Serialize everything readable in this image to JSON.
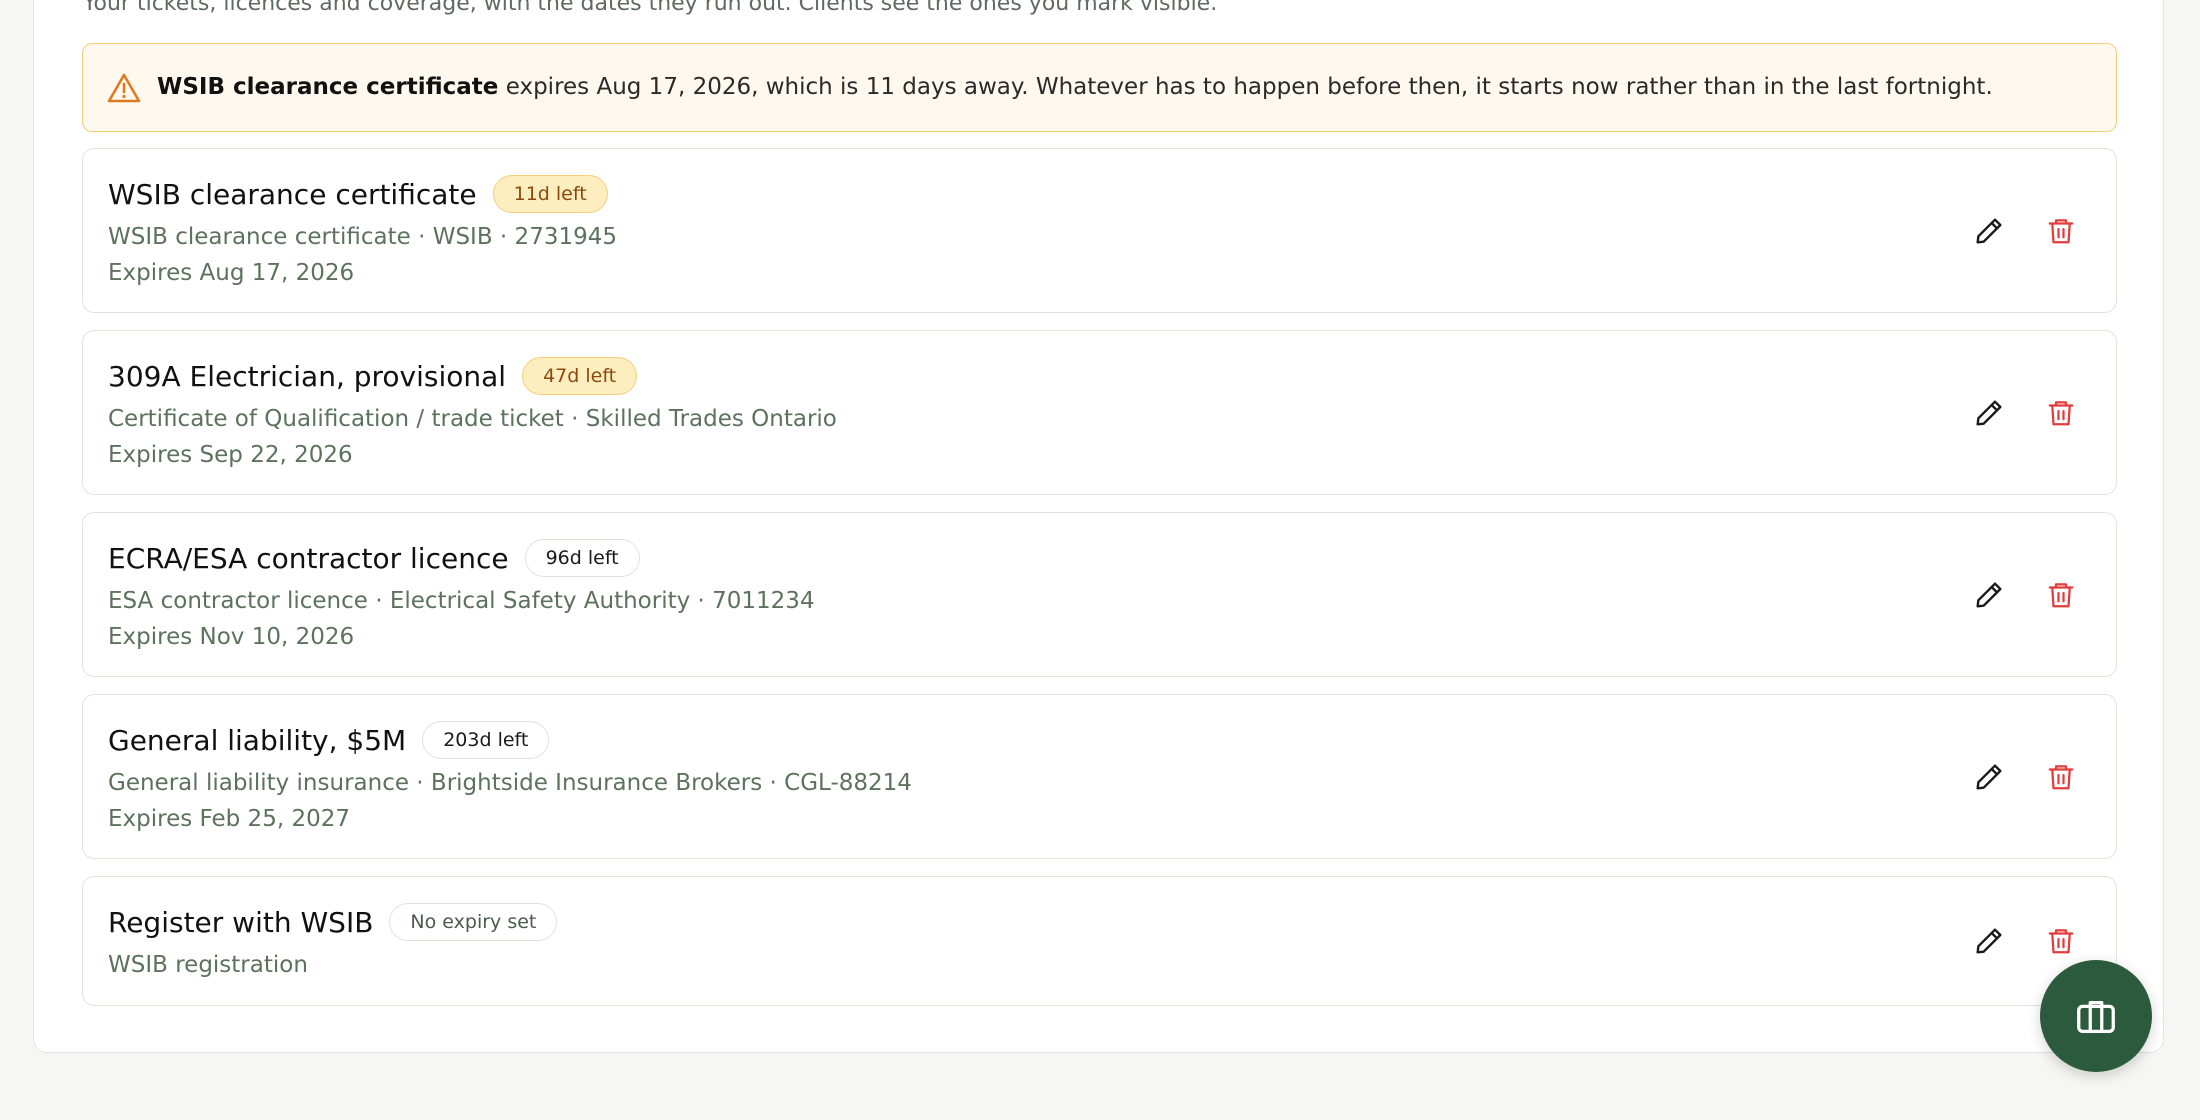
{
  "intro_text": "Your tickets, licences and coverage, with the dates they run out. Clients see the ones you mark visible.",
  "alert": {
    "icon": "warning-triangle-icon",
    "bold": "WSIB clearance certificate",
    "text": " expires Aug 17, 2026, which is 11 days away. Whatever has to happen before then, it starts now rather than in the last fortnight."
  },
  "credentials": [
    {
      "title": "WSIB clearance certificate",
      "badge": "11d left",
      "meta": "WSIB clearance certificate · WSIB · 2731945",
      "expires": "Expires Aug 17, 2026"
    },
    {
      "title": "309A Electrician, provisional",
      "badge": "47d left",
      "meta": "Certificate of Qualification / trade ticket · Skilled Trades Ontario",
      "expires": "Expires Sep 22, 2026"
    },
    {
      "title": "ECRA/ESA contractor licence",
      "badge": "96d left",
      "meta": "ESA contractor licence · Electrical Safety Authority · 7011234",
      "expires": "Expires Nov 10, 2026"
    },
    {
      "title": "General liability, $5M",
      "badge": "203d left",
      "meta": "General liability insurance · Brightside Insurance Brokers · CGL-88214",
      "expires": "Expires Feb 25, 2027"
    },
    {
      "title": "Register with WSIB",
      "badge": "No expiry set",
      "meta": "WSIB registration",
      "expires": ""
    }
  ],
  "icons": {
    "edit": "pencil-icon",
    "delete": "trash-icon",
    "fab": "briefcase-icon"
  },
  "colors": {
    "accent": "#2c5a3c",
    "warning_bg": "#fff8ef",
    "warning_border": "#f3cf7c",
    "badge_warn_bg": "#fdedbf",
    "delete_red": "#e23c3c"
  }
}
